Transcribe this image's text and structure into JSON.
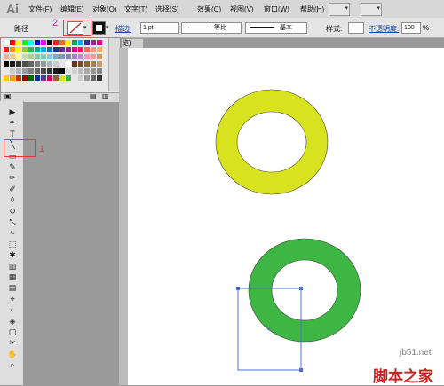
{
  "app": {
    "logo": "Ai"
  },
  "menubar": {
    "items": [
      "文件(F)",
      "编辑(E)",
      "对象(O)",
      "文字(T)",
      "选择(S)",
      "效果(C)",
      "视图(V)",
      "窗口(W)",
      "帮助(H)"
    ]
  },
  "controlbar": {
    "path_label": "路径",
    "stroke_label": "描边:",
    "stroke_value": "1 pt",
    "profile_label": "等比",
    "brush_label": "基本",
    "style_label": "样式:",
    "opacity_label": "不透明度:",
    "opacity_value": "100",
    "opacity_unit": "%"
  },
  "doc": {
    "tab_label": "览)"
  },
  "annotations": {
    "label_1": "1",
    "label_2": "2",
    "color": "#e53a3a",
    "label2_color": "#c020c0"
  },
  "canvas": {
    "ring_top_color": "#d8e21e",
    "ring_bottom_color": "#3db643",
    "selection_color": "#4a6fd0"
  },
  "watermark": {
    "site": "jb51.net",
    "brand": "脚本之家"
  }
}
